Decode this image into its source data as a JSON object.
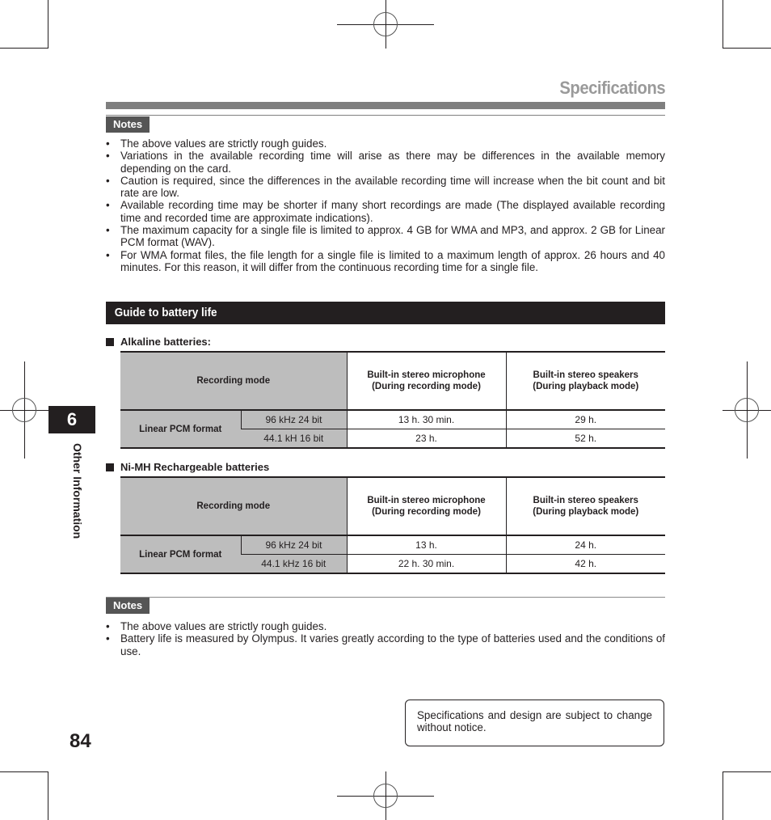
{
  "page": {
    "title": "Specifications",
    "page_number": "84",
    "chapter_number": "6",
    "chapter_label": "Other Information"
  },
  "notes_top": {
    "label": "Notes",
    "items": [
      "The above values are strictly rough guides.",
      "Variations in the available recording time will arise as there may be differences in the available memory depending on the card.",
      "Caution is required, since the differences in the available recording time will increase when the bit count and bit rate are low.",
      "Available recording time may be shorter if many short recordings are made (The displayed available recording time and recorded time are approximate indications).",
      "The maximum capacity for a single file is limited to approx. 4 GB for WMA and MP3, and approx. 2 GB for Linear PCM format (WAV).",
      "For WMA format files, the file length for a single file is limited to a maximum length of approx. 26 hours and 40 minutes. For this reason, it will differ from the continuous recording time for a single file."
    ]
  },
  "battery_section": {
    "title": "Guide to battery life",
    "tables": [
      {
        "heading": "Alkaline batteries:",
        "headers": {
          "mode": "Recording mode",
          "col1": "Built-in stereo microphone\n(During recording mode)",
          "col2": "Built-in stereo speakers\n(During playback mode)"
        },
        "format": "Linear PCM format",
        "rows": [
          {
            "mode": "96 kHz 24 bit",
            "recording": "13 h. 30 min.",
            "playback": "29 h."
          },
          {
            "mode": "44.1 kH 16 bit",
            "recording": "23 h.",
            "playback": "52 h."
          }
        ]
      },
      {
        "heading": "Ni-MH Rechargeable batteries",
        "headers": {
          "mode": "Recording mode",
          "col1": "Built-in stereo microphone\n(During recording mode)",
          "col2": "Built-in stereo speakers\n(During playback mode)"
        },
        "format": "Linear PCM format",
        "rows": [
          {
            "mode": "96 kHz 24 bit",
            "recording": "13 h.",
            "playback": "24 h."
          },
          {
            "mode": "44.1 kHz 16 bit",
            "recording": "22 h. 30 min.",
            "playback": "42 h."
          }
        ]
      }
    ]
  },
  "notes_bottom": {
    "label": "Notes",
    "items": [
      "The above values are strictly rough guides.",
      "Battery life is measured by Olympus. It varies greatly according to the type of batteries used and the conditions of use."
    ]
  },
  "notice": "Specifications and design are subject to change without notice."
}
